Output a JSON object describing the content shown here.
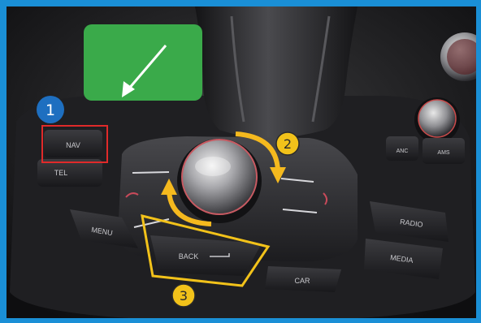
{
  "labels": {
    "nav_button": "NAV",
    "tel_button": "TEL",
    "menu_button": "MENU",
    "back_button": "BACK",
    "car_button": "CAR",
    "radio_button": "RADIO",
    "media_button": "MEDIA",
    "knob_left_button": "ANC",
    "knob_right_button": "AMS"
  },
  "badges": {
    "step_1": "1",
    "step_2": "2",
    "step_3": "3"
  },
  "colors": {
    "frame": "#1a8fd6",
    "tile": "#3aaa4a",
    "step_1_badge": "#1e6fc0",
    "step_badge": "#f2c21a",
    "highlight_red": "#e02a2a",
    "highlight_yellow": "#f2c21a",
    "arrow_yellow": "#f5b91e"
  },
  "icons": {
    "tile_arrow": "down-left-arrow-icon",
    "rotate_arrow_right": "rotate-clockwise-arrow-icon",
    "rotate_arrow_left": "rotate-counterclockwise-arrow-icon"
  }
}
